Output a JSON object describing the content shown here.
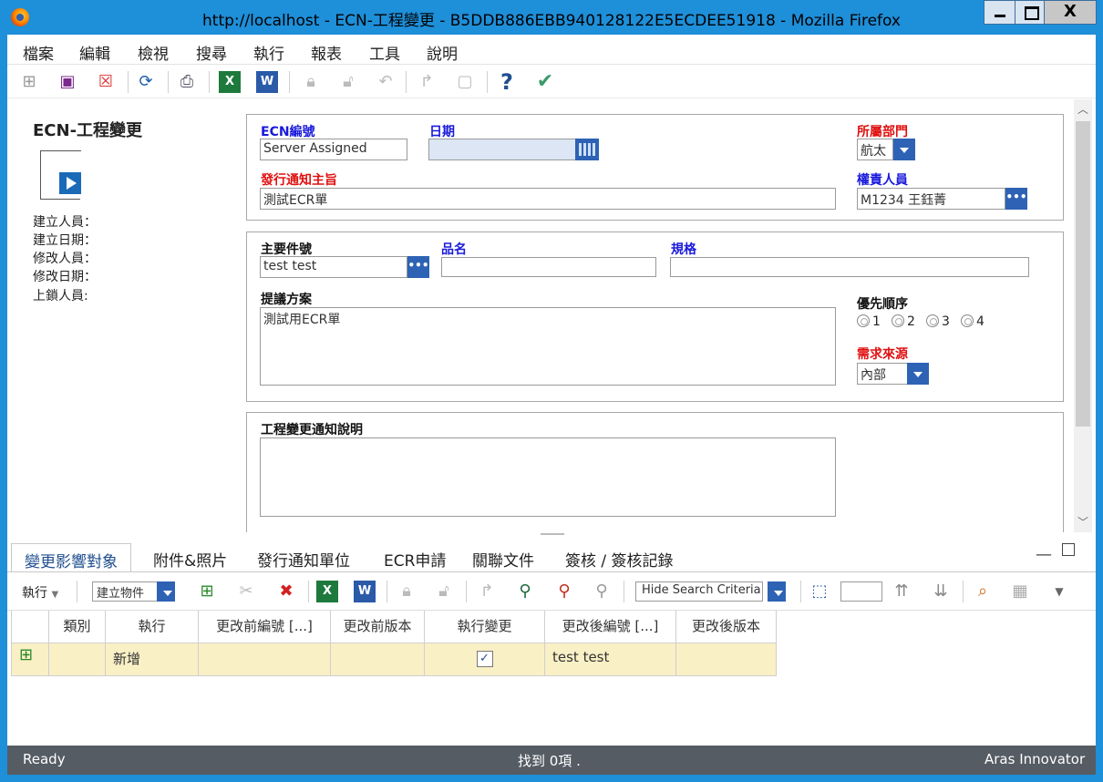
{
  "window": {
    "title": "http://localhost - ECN-工程變更 - B5DDB886EBB940128122E5ECDEE51918 - Mozilla Firefox",
    "close_glyph": "X"
  },
  "menu": [
    "檔案",
    "編輯",
    "檢視",
    "搜尋",
    "執行",
    "報表",
    "工具",
    "說明"
  ],
  "toolbar_icons": [
    "new-icon",
    "save-icon",
    "delete-icon",
    "refresh-icon",
    "print-icon",
    "excel-icon",
    "word-icon",
    "lock-icon",
    "unlock-icon",
    "undo-icon",
    "promote-icon",
    "clipboard-icon",
    "help-icon",
    "done-icon"
  ],
  "left": {
    "title": "ECN-工程變更",
    "meta": [
      "建立人員：",
      "建立日期：",
      "修改人員：",
      "修改日期：",
      "上鎖人員:"
    ]
  },
  "form": {
    "ecn_no": {
      "label": "ECN編號",
      "value": "Server Assigned"
    },
    "date": {
      "label": "日期",
      "value": ""
    },
    "dept": {
      "label": "所屬部門",
      "value": "航太"
    },
    "subject": {
      "label": "發行通知主旨",
      "value": "測試ECR單"
    },
    "owner": {
      "label": "權責人員",
      "value": "M1234 王鈺菁"
    },
    "main_part": {
      "label": "主要件號",
      "value": "test test"
    },
    "part_name": {
      "label": "品名",
      "value": ""
    },
    "spec": {
      "label": "規格",
      "value": ""
    },
    "proposal": {
      "label": "提議方案",
      "value": "測試用ECR單"
    },
    "priority": {
      "label": "優先順序",
      "options": [
        "1",
        "2",
        "3",
        "4"
      ]
    },
    "source": {
      "label": "需求來源",
      "value": "內部"
    },
    "notice": {
      "label": "工程變更通知說明",
      "value": ""
    }
  },
  "tabs": [
    "變更影響對象",
    "附件&照片",
    "發行通知單位",
    "ECR申請",
    "關聯文件",
    "簽核 / 簽核記錄"
  ],
  "grid_toolbar": {
    "action_label": "執行",
    "create_item": "建立物件",
    "hide_search": "Hide Search Criteria",
    "page_value": ""
  },
  "grid": {
    "columns": [
      "類別",
      "執行",
      "更改前編號 [...]",
      "更改前版本",
      "執行變更",
      "更改後編號 [...]",
      "更改後版本"
    ],
    "rows": [
      {
        "category": "",
        "action": "新增",
        "before_no": "",
        "before_ver": "",
        "apply": "✓",
        "after_no": "test test",
        "after_ver": ""
      }
    ]
  },
  "status": {
    "left": "Ready",
    "center": "找到 0項 .",
    "right": "Aras Innovator"
  }
}
